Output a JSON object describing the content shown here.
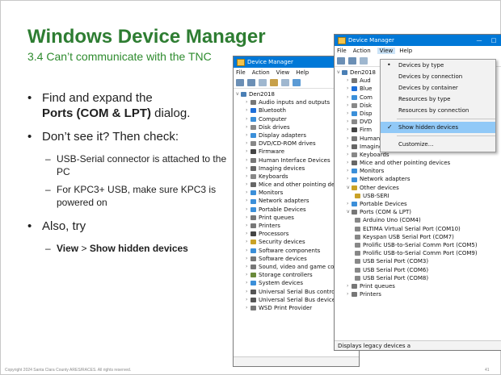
{
  "slide": {
    "title": "Windows Device Manager",
    "subtitle": "3.4 Can’t communicate with the TNC",
    "bullets": {
      "b1_line1": "Find and expand the",
      "b1_bold": "Ports (COM & LPT)",
      "b1_tail": " dialog.",
      "b2": "Don’t see it?  Then check:",
      "b2_sub1": "USB-Serial connector is attached to the PC",
      "b2_sub2": "For KPC3+ USB, make sure KPC3 is powered on",
      "b3": "Also, try",
      "b3_sub_view": "View",
      "b3_sub_sep": " > ",
      "b3_sub_show": "Show hidden devices"
    },
    "footer": "Copyright 2024 Santa Clara County ARES/RACES.  All rights reserved.",
    "page_number": "41"
  },
  "win1": {
    "title": "Device Manager",
    "menu": [
      "File",
      "Action",
      "View",
      "Help"
    ],
    "root": "Den2018",
    "items": [
      "Audio inputs and outputs",
      "Bluetooth",
      "Computer",
      "Disk drives",
      "Display adapters",
      "DVD/CD-ROM drives",
      "Firmware",
      "Human Interface Devices",
      "Imaging devices",
      "Keyboards",
      "Mice and other pointing devices",
      "Monitors",
      "Network adapters",
      "Portable Devices",
      "Print queues",
      "Printers",
      "Processors",
      "Security devices",
      "Software components",
      "Software devices",
      "Sound, video and game controllers",
      "Storage controllers",
      "System devices",
      "Universal Serial Bus controllers",
      "Universal Serial Bus devices",
      "WSD Print Provider"
    ]
  },
  "win2": {
    "title": "Device Manager",
    "title_buttons": [
      "—",
      "□"
    ],
    "menu": [
      "File",
      "Action",
      "View",
      "Help"
    ],
    "root": "Den2018",
    "top_items": [
      "Aud",
      "Blue",
      "Com",
      "Disk",
      "Disp",
      "DVD",
      "Firm"
    ],
    "items": [
      "Human Interface Devices",
      "Imaging devices",
      "Keyboards",
      "Mice and other pointing devices",
      "Monitors",
      "Network adapters"
    ],
    "other_devices": "Other devices",
    "other_child": "USB-SERI",
    "portable": "Portable Devices",
    "ports": "Ports (COM & LPT)",
    "ports_children": [
      "Arduino Uno (COM4)",
      "ELTIMA Virtual Serial Port (COM10)",
      "Keyspan USB Serial Port (COM7)",
      "Prolific USB-to-Serial Comm Port (COM5)",
      "Prolific USB-to-Serial Comm Port (COM9)",
      "USB Serial Port (COM3)",
      "USB Serial Port (COM6)",
      "USB Serial Port (COM8)"
    ],
    "after": [
      "Print queues",
      "Printers"
    ],
    "status": "Displays legacy devices a"
  },
  "view_menu": {
    "items": [
      {
        "label": "Devices by type",
        "mark": "•"
      },
      {
        "label": "Devices by connection",
        "mark": ""
      },
      {
        "label": "Devices by container",
        "mark": ""
      },
      {
        "label": "Resources by type",
        "mark": ""
      },
      {
        "label": "Resources by connection",
        "mark": ""
      },
      {
        "label": "Show hidden devices",
        "mark": "✓"
      },
      {
        "label": "Customize...",
        "mark": ""
      }
    ],
    "highlighted": "Show hidden devices"
  },
  "colors": {
    "title_green": "#2e7d32",
    "titlebar_blue": "#0078d7",
    "menu_highlight": "#91c9f7"
  }
}
